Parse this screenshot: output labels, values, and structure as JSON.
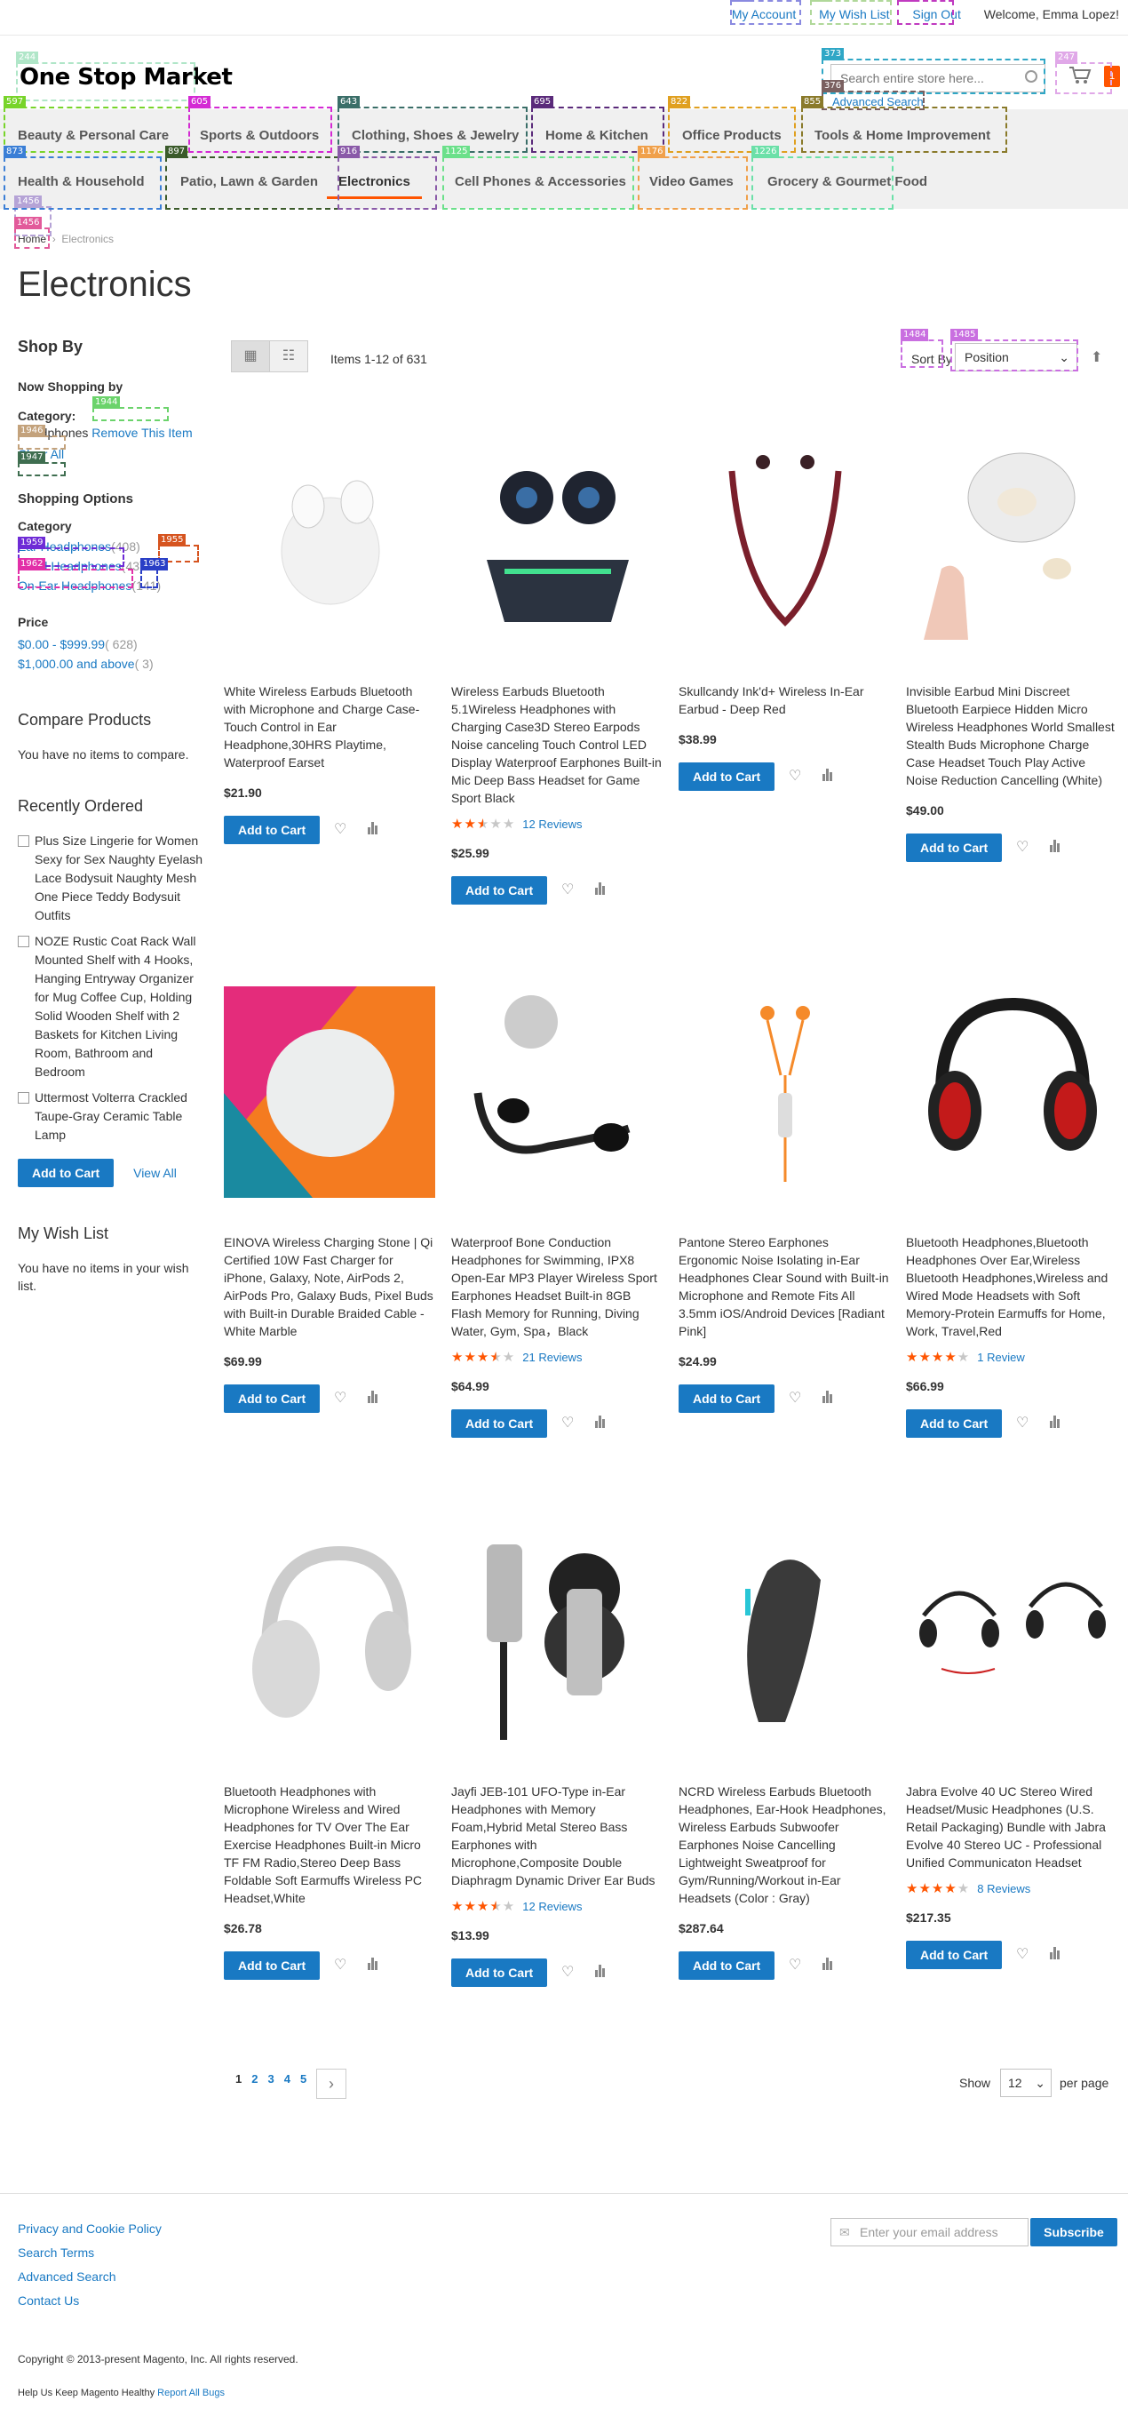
{
  "header": {
    "links": [
      "My Account",
      "My Wish List",
      "Sign Out"
    ],
    "welcome": "Welcome, Emma Lopez!",
    "logo": "One Stop Market",
    "search_placeholder": "Search entire store here...",
    "advanced_search": "Advanced Search",
    "cart_count": "1"
  },
  "nav": {
    "row1": [
      "Beauty & Personal Care",
      "Sports & Outdoors",
      "Clothing, Shoes & Jewelry",
      "Home & Kitchen",
      "Office Products",
      "Tools & Home Improvement"
    ],
    "row2": [
      "Health & Household",
      "Patio, Lawn & Garden",
      "Electronics",
      "Cell Phones & Accessories",
      "Video Games",
      "Grocery & Gourmet Food"
    ],
    "active": "Electronics"
  },
  "breadcrumb": {
    "home": "Home",
    "current": "Electronics"
  },
  "page_title": "Electronics",
  "sidebar": {
    "shop_by": "Shop By",
    "now_shopping": "Now Shopping by",
    "category_label": "Category:",
    "category_value": "Headphones",
    "remove": "Remove This Item",
    "clear_all": "Clear All",
    "shopping_options": "Shopping Options",
    "category_heading": "Category",
    "categories": [
      {
        "label": "Ear Headphones",
        "count": "408"
      },
      {
        "label": "Hand Headphones",
        "count": "43"
      },
      {
        "label": "On-Ear Headphones",
        "count": "141"
      }
    ],
    "price_heading": "Price",
    "prices": [
      {
        "label": "$0.00 - $999.99",
        "count": "628"
      },
      {
        "label": "$1,000.00 and above",
        "count": "3"
      }
    ],
    "compare_heading": "Compare Products",
    "compare_text": "You have no items to compare.",
    "recent_heading": "Recently Ordered",
    "recent_items": [
      "Plus Size Lingerie for Women Sexy for Sex Naughty Eyelash Lace Bodysuit Naughty Mesh One Piece Teddy Bodysuit Outfits",
      "NOZE Rustic Coat Rack Wall Mounted Shelf with 4 Hooks, Hanging Entryway Organizer for Mug Coffee Cup, Holding Solid Wooden Shelf with 2 Baskets for Kitchen Living Room, Bathroom and Bedroom",
      "Uttermost Volterra Crackled Taupe-Gray Ceramic Table Lamp"
    ],
    "recent_add": "Add to Cart",
    "view_all": "View All",
    "wishlist_heading": "My Wish List",
    "wishlist_text": "You have no items in your wish list."
  },
  "toolbar": {
    "items_count": "Items 1-12 of 631",
    "sort_label": "Sort By",
    "sort_value": "Position"
  },
  "products": [
    {
      "name": "White Wireless Earbuds Bluetooth with Microphone and Charge Case-Touch Control in Ear Headphone,30HRS Playtime, Waterproof Earset",
      "price": "$21.90",
      "rating": 0,
      "reviews": ""
    },
    {
      "name": "Wireless Earbuds Bluetooth 5.1Wireless Headphones with Charging Case3D Stereo Earpods Noise canceling Touch Control LED Display Waterproof Earphones Built-in Mic Deep Bass Headset for Game Sport Black",
      "price": "$25.99",
      "rating": 2.5,
      "reviews": "12  Reviews"
    },
    {
      "name": "Skullcandy Ink'd+ Wireless In-Ear Earbud - Deep Red",
      "price": "$38.99",
      "rating": 0,
      "reviews": ""
    },
    {
      "name": "Invisible Earbud Mini Discreet Bluetooth Earpiece Hidden Micro Wireless Headphones World Smallest Stealth Buds Microphone Charge Case Headset Touch Play Active Noise Reduction Cancelling (White)",
      "price": "$49.00",
      "rating": 0,
      "reviews": ""
    },
    {
      "name": "EINOVA Wireless Charging Stone | Qi Certified 10W Fast Charger for iPhone, Galaxy, Note, AirPods 2, AirPods Pro, Galaxy Buds, Pixel Buds with Built-in Durable Braided Cable - White Marble",
      "price": "$69.99",
      "rating": 0,
      "reviews": ""
    },
    {
      "name": "Waterproof Bone Conduction Headphones for Swimming, IPX8 Open-Ear MP3 Player Wireless Sport Earphones Headset Built-in 8GB Flash Memory for Running, Diving Water, Gym, Spa，Black",
      "price": "$64.99",
      "rating": 3.5,
      "reviews": "21  Reviews"
    },
    {
      "name": "Pantone Stereo Earphones Ergonomic Noise Isolating in-Ear Headphones Clear Sound with Built-in Microphone and Remote Fits All 3.5mm iOS/Android Devices [Radiant Pink]",
      "price": "$24.99",
      "rating": 0,
      "reviews": ""
    },
    {
      "name": "Bluetooth Headphones,Bluetooth Headphones Over Ear,Wireless Bluetooth Headphones,Wireless and Wired Mode Headsets with Soft Memory-Protein Earmuffs for Home, Work, Travel,Red",
      "price": "$66.99",
      "rating": 4,
      "reviews": "1  Review"
    },
    {
      "name": "Bluetooth Headphones with Microphone Wireless and Wired Headphones for TV Over The Ear Exercise Headphones Built-in Micro TF FM Radio,Stereo Deep Bass Foldable Soft Earmuffs Wireless PC Headset,White",
      "price": "$26.78",
      "rating": 0,
      "reviews": ""
    },
    {
      "name": "Jayfi JEB-101 UFO-Type in-Ear Headphones with Memory Foam,Hybrid Metal Stereo Bass Earphones with Microphone,Composite Double Diaphragm Dynamic Driver Ear Buds",
      "price": "$13.99",
      "rating": 3.5,
      "reviews": "12  Reviews"
    },
    {
      "name": "NCRD Wireless Earbuds Bluetooth Headphones, Ear-Hook Headphones, Wireless Earbuds Subwoofer Earphones Noise Cancelling Lightweight Sweatproof for Gym/Running/Workout in-Ear Headsets (Color : Gray)",
      "price": "$287.64",
      "rating": 0,
      "reviews": ""
    },
    {
      "name": "Jabra Evolve 40 UC Stereo Wired Headset/Music Headphones (U.S. Retail Packaging) Bundle with Jabra Evolve 40 Stereo UC - Professional Unified Communicaton Headset",
      "price": "$217.35",
      "rating": 4,
      "reviews": "8  Reviews"
    }
  ],
  "add_to_cart": "Add to Cart",
  "pagination": {
    "pages": [
      "1",
      "2",
      "3",
      "4",
      "5"
    ],
    "show": "Show",
    "limit": "12",
    "per_page": "per page"
  },
  "footer": {
    "links": [
      "Privacy and Cookie Policy",
      "Search Terms",
      "Advanced Search",
      "Contact Us"
    ],
    "newsletter_placeholder": "Enter your email address",
    "subscribe": "Subscribe",
    "copyright": "Copyright © 2013-present Magento, Inc. All rights reserved.",
    "help_text": "Help Us Keep Magento Healthy",
    "report": "Report All Bugs"
  },
  "som_tags": [
    "1456",
    "1944",
    "1946",
    "1947",
    "1955",
    "1957",
    "1958",
    "1959",
    "1961",
    "1962",
    "1963",
    "1484",
    "1485",
    "373",
    "376",
    "244",
    "247",
    "597",
    "605",
    "643",
    "695",
    "822",
    "855",
    "873",
    "897",
    "916",
    "1125",
    "1176",
    "1226",
    "227",
    "231",
    "233"
  ],
  "colors": {
    "accent": "#1979c3",
    "orange": "#ff5501",
    "nav_bg": "#f0f0f0"
  }
}
